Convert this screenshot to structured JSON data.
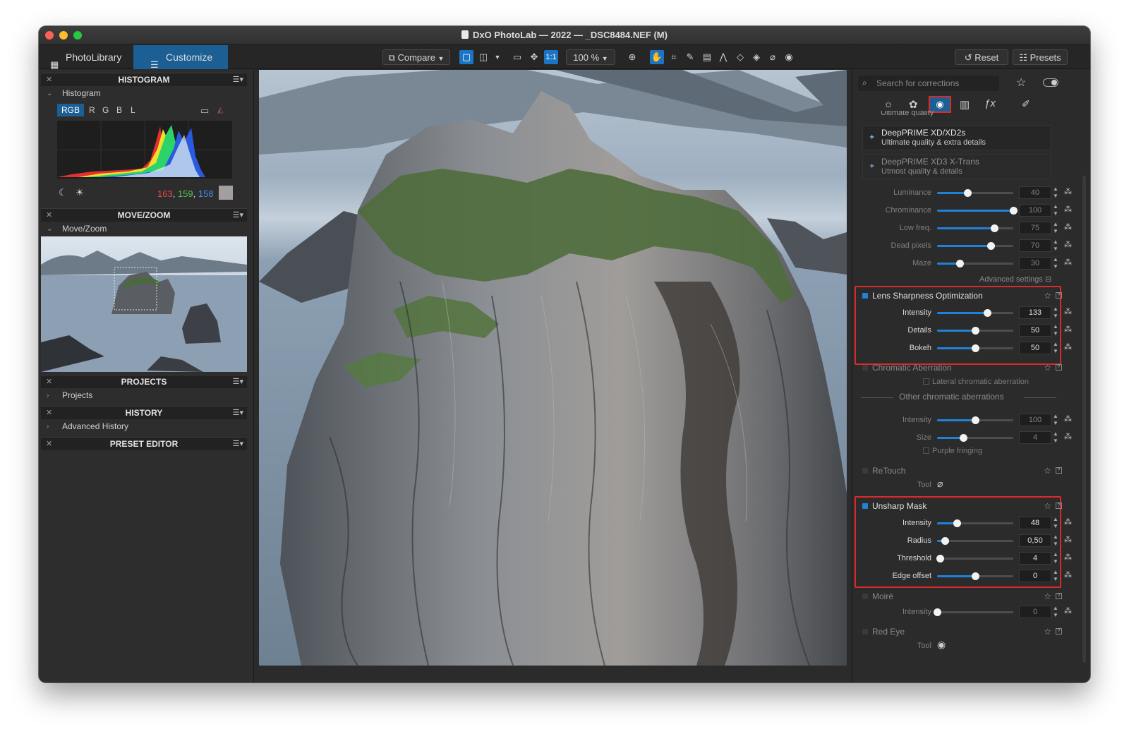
{
  "window": {
    "title": "DxO PhotoLab — 2022 — _DSC8484.NEF (M)"
  },
  "toolbar": {
    "tab_library": "PhotoLibrary",
    "tab_customize": "Customize",
    "compare": "Compare",
    "zoom": "100 %",
    "one_to_one": "1:1",
    "reset": "Reset",
    "presets": "Presets"
  },
  "left": {
    "histogram_header": "HISTOGRAM",
    "histogram_sub": "Histogram",
    "channels": [
      "RGB",
      "R",
      "G",
      "B",
      "L"
    ],
    "pixel_r": "163",
    "pixel_g": "159",
    "pixel_b": "158",
    "sep": ",",
    "movezoom_header": "MOVE/ZOOM",
    "movezoom_sub": "Move/Zoom",
    "projects_header": "PROJECTS",
    "projects_sub": "Projects",
    "history_header": "HISTORY",
    "history_sub": "Advanced History",
    "preset_header": "PRESET EDITOR"
  },
  "right": {
    "search_placeholder": "Search for corrections",
    "partial_text": "Ultimate quality",
    "dp_xd_title": "DeepPRIME XD/XD2s",
    "dp_xd_sub": "Ultimate quality & extra details",
    "dp_xd3_title": "DeepPRIME XD3 X-Trans",
    "dp_xd3_sub": "Utmost quality & details",
    "noise_rows": [
      {
        "label": "Luminance",
        "value": "40",
        "pct": 40
      },
      {
        "label": "Chrominance",
        "value": "100",
        "pct": 100
      },
      {
        "label": "Low freq.",
        "value": "75",
        "pct": 75
      },
      {
        "label": "Dead pixels",
        "value": "70",
        "pct": 70
      },
      {
        "label": "Maze",
        "value": "30",
        "pct": 30
      }
    ],
    "advanced_settings": "Advanced settings",
    "lens_title": "Lens Sharpness Optimization",
    "lens_rows": [
      {
        "label": "Intensity",
        "value": "133",
        "pct": 66
      },
      {
        "label": "Details",
        "value": "50",
        "pct": 50
      },
      {
        "label": "Bokeh",
        "value": "50",
        "pct": 50
      }
    ],
    "ca_title": "Chromatic Aberration",
    "ca_lateral": "Lateral chromatic aberration",
    "ca_other": "Other chromatic aberrations",
    "ca_rows": [
      {
        "label": "Intensity",
        "value": "100",
        "pct": 50
      },
      {
        "label": "Size",
        "value": "4",
        "pct": 34
      }
    ],
    "ca_purple": "Purple fringing",
    "retouch_title": "ReTouch",
    "tool_label": "Tool",
    "unsharp_title": "Unsharp Mask",
    "unsharp_rows": [
      {
        "label": "Intensity",
        "value": "48",
        "pct": 26
      },
      {
        "label": "Radius",
        "value": "0,50",
        "pct": 10
      },
      {
        "label": "Threshold",
        "value": "4",
        "pct": 4
      },
      {
        "label": "Edge offset",
        "value": "0",
        "pct": 50
      }
    ],
    "moire_title": "Moiré",
    "moire_rows": [
      {
        "label": "Intensity",
        "value": "0",
        "pct": 0
      }
    ],
    "redeye_title": "Red Eye"
  },
  "colors": {
    "accent": "#1f82d6",
    "highlight": "#d92b2b"
  }
}
